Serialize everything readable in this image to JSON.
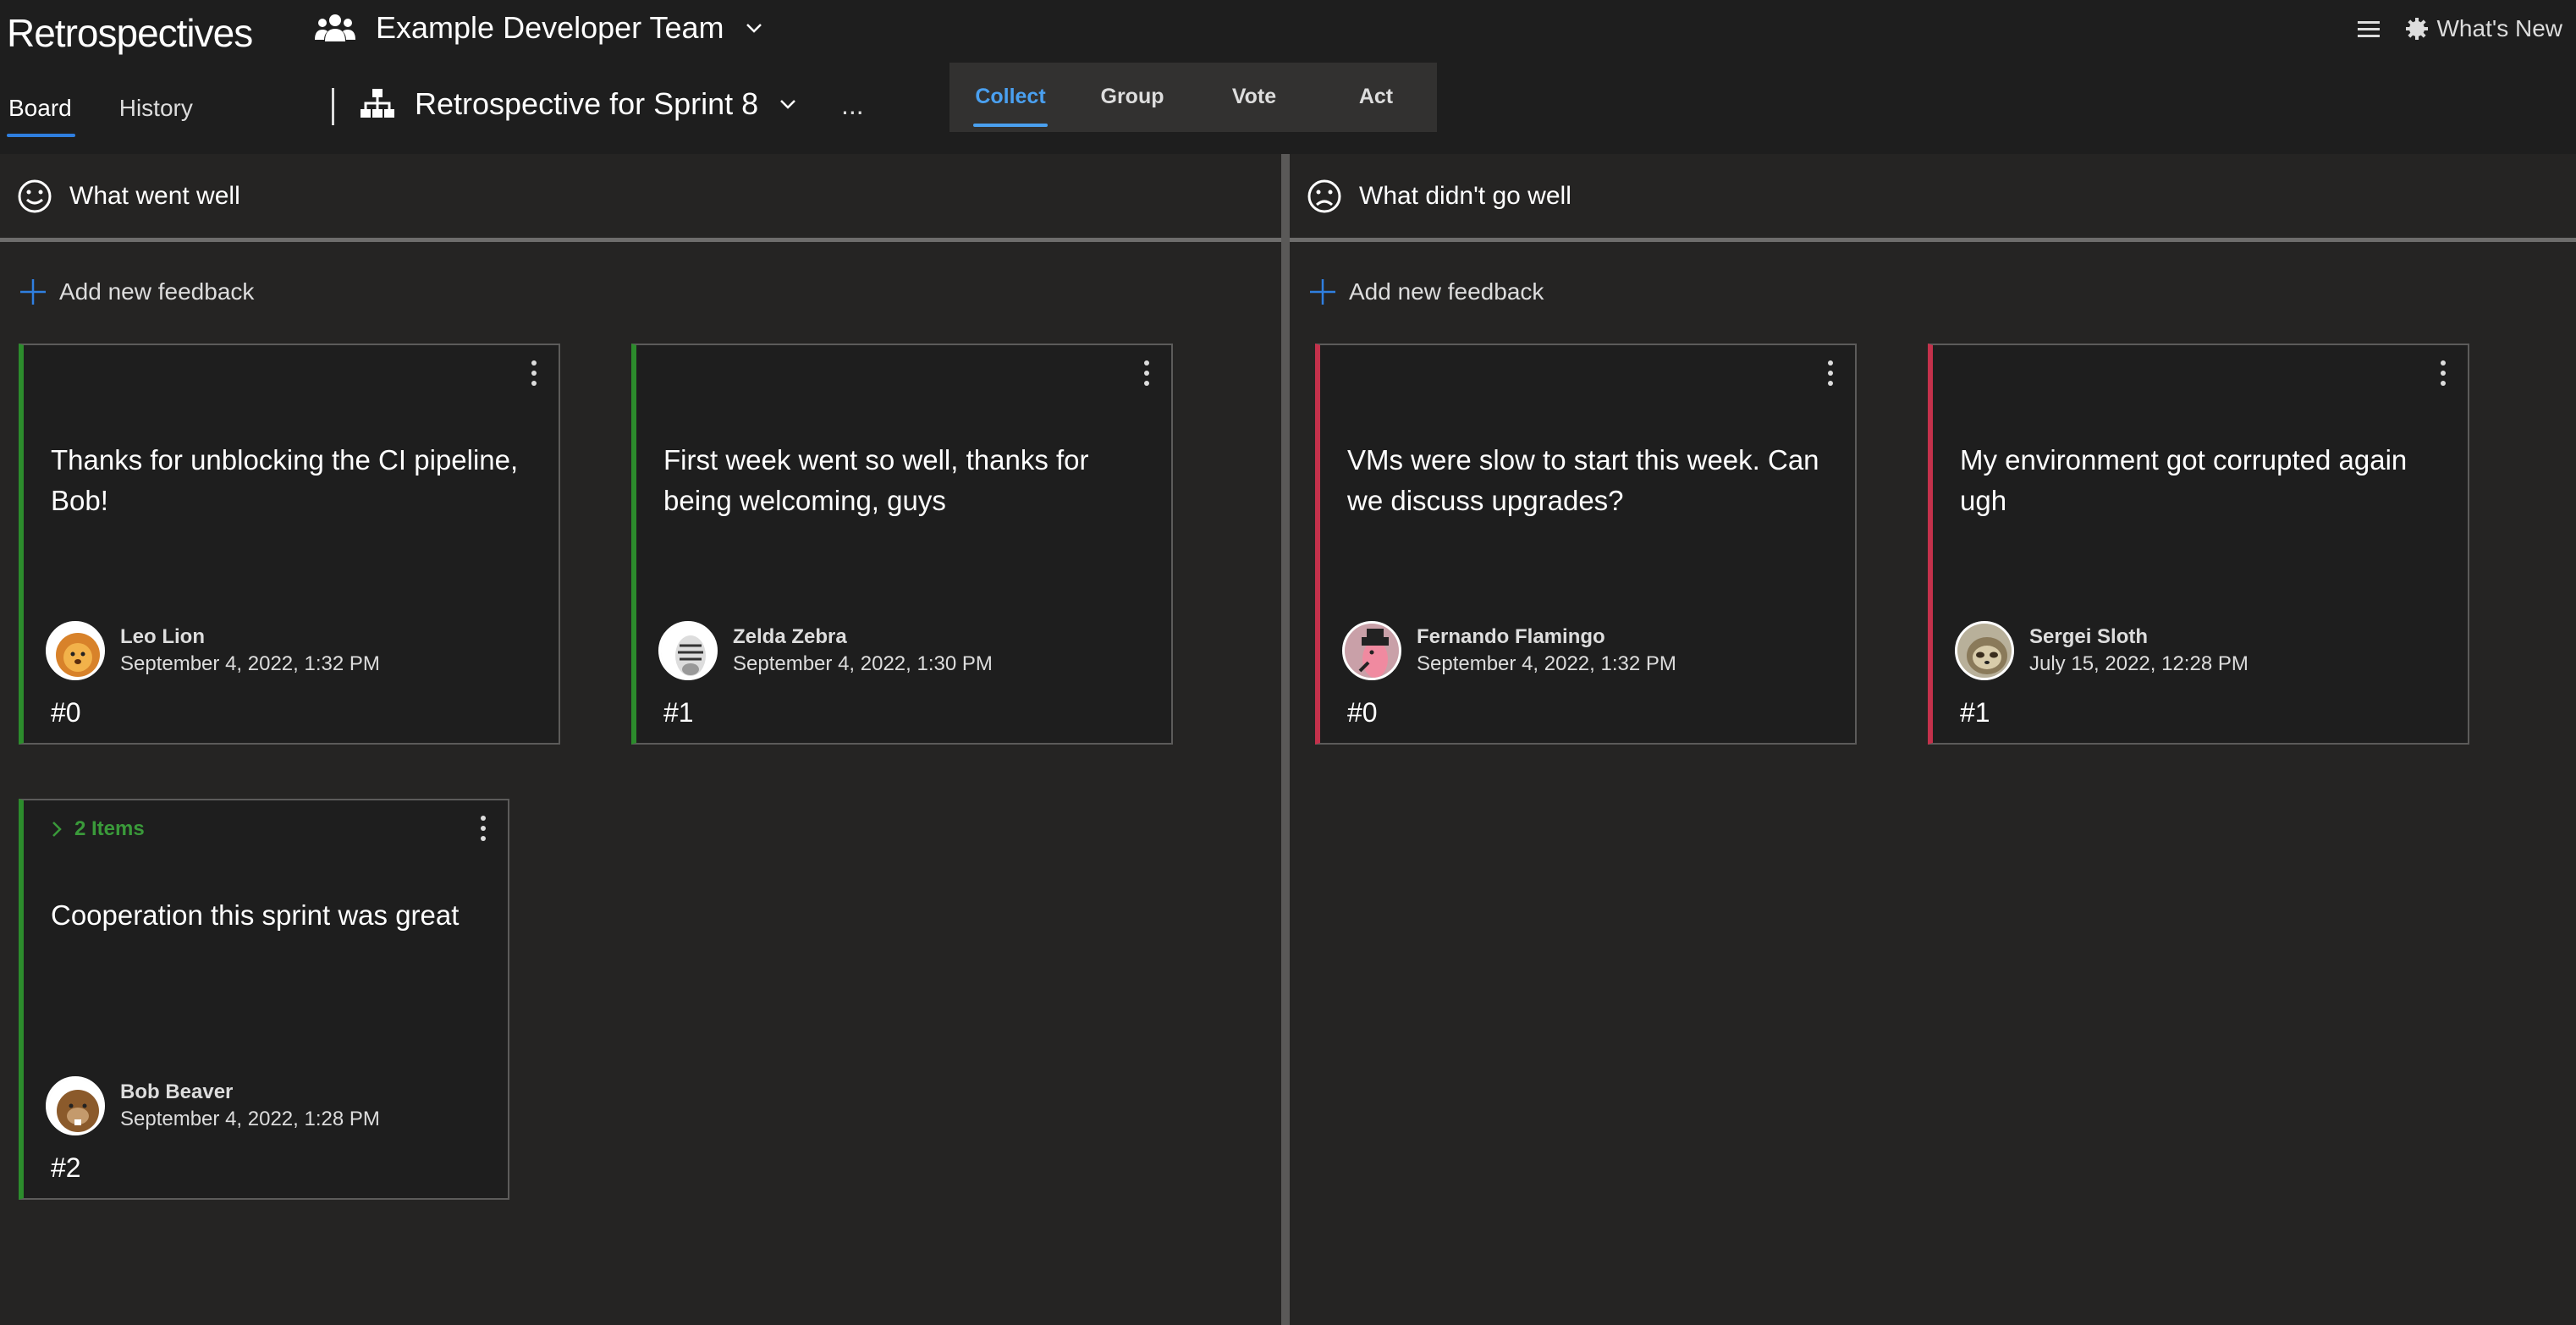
{
  "app": {
    "title": "Retrospectives"
  },
  "team": {
    "name": "Example Developer Team",
    "icon": "people-icon"
  },
  "top_right": {
    "menu_icon": "hamburger-icon",
    "whats_new": "What's New"
  },
  "tabs": [
    {
      "label": "Board",
      "active": true
    },
    {
      "label": "History",
      "active": false
    }
  ],
  "retro": {
    "title": "Retrospective for Sprint 8",
    "more": "..."
  },
  "phases": [
    {
      "label": "Collect",
      "active": true
    },
    {
      "label": "Group",
      "active": false
    },
    {
      "label": "Vote",
      "active": false
    },
    {
      "label": "Act",
      "active": false
    }
  ],
  "columns": [
    {
      "title": "What went well",
      "icon": "smile-icon",
      "add_label": "Add new feedback",
      "accent": "#2c8c2c",
      "cards": [
        {
          "text": "Thanks for unblocking the CI pipeline, Bob!",
          "author": "Leo Lion",
          "date": "September 4, 2022, 1:32 PM",
          "number": "#0"
        },
        {
          "text": "First week went so well, thanks for being welcoming, guys",
          "author": "Zelda Zebra",
          "date": "September 4, 2022, 1:30 PM",
          "number": "#1"
        },
        {
          "group_label": "2 Items",
          "text": "Cooperation this sprint was great",
          "author": "Bob Beaver",
          "date": "September 4, 2022, 1:28 PM",
          "number": "#2"
        }
      ]
    },
    {
      "title": "What didn't go well",
      "icon": "frown-icon",
      "add_label": "Add new feedback",
      "accent": "#c4314b",
      "cards": [
        {
          "text": "VMs were slow to start this week. Can we discuss upgrades?",
          "author": "Fernando Flamingo",
          "date": "September 4, 2022, 1:32 PM",
          "number": "#0"
        },
        {
          "text": "My environment got corrupted again ugh",
          "author": "Sergei Sloth",
          "date": "July 15, 2022, 12:28 PM",
          "number": "#1"
        }
      ]
    }
  ]
}
